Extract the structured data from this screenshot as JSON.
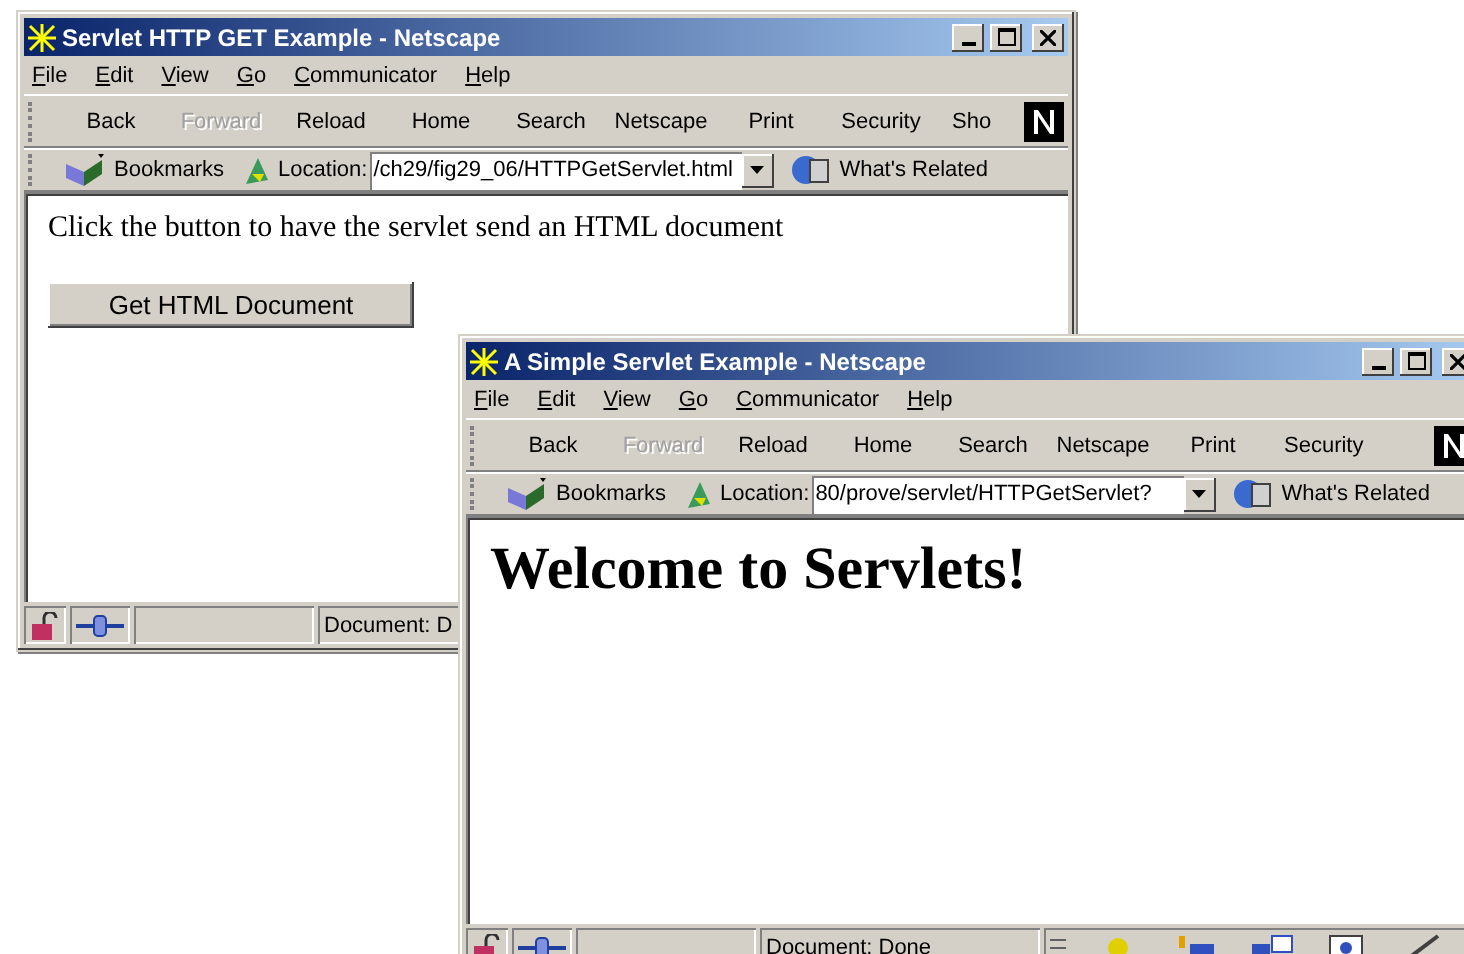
{
  "windows": [
    {
      "title": "Servlet HTTP GET Example - Netscape",
      "menus": [
        "File",
        "Edit",
        "View",
        "Go",
        "Communicator",
        "Help"
      ],
      "toolbar": [
        {
          "label": "Back",
          "disabled": false
        },
        {
          "label": "Forward",
          "disabled": true
        },
        {
          "label": "Reload",
          "disabled": false
        },
        {
          "label": "Home",
          "disabled": false
        },
        {
          "label": "Search",
          "disabled": false
        },
        {
          "label": "Netscape",
          "disabled": false
        },
        {
          "label": "Print",
          "disabled": false
        },
        {
          "label": "Security",
          "disabled": false
        },
        {
          "label": "Sho",
          "disabled": false
        }
      ],
      "bookmarks": "Bookmarks",
      "location_label": "Location:",
      "url": "/ch29/fig29_06/HTTPGetServlet.html",
      "related": "What's Related",
      "content": [
        {
          "kind": "paragraph",
          "text": "Click the button to have the servlet send an HTML document"
        },
        {
          "kind": "button",
          "text": "Get HTML Document"
        }
      ],
      "status": "Document: D",
      "component_bar": false
    },
    {
      "title": "A Simple Servlet Example - Netscape",
      "menus": [
        "File",
        "Edit",
        "View",
        "Go",
        "Communicator",
        "Help"
      ],
      "toolbar": [
        {
          "label": "Back",
          "disabled": false
        },
        {
          "label": "Forward",
          "disabled": true
        },
        {
          "label": "Reload",
          "disabled": false
        },
        {
          "label": "Home",
          "disabled": false
        },
        {
          "label": "Search",
          "disabled": false
        },
        {
          "label": "Netscape",
          "disabled": false
        },
        {
          "label": "Print",
          "disabled": false
        },
        {
          "label": "Security",
          "disabled": false
        }
      ],
      "bookmarks": "Bookmarks",
      "location_label": "Location:",
      "url": "80/prove/servlet/HTTPGetServlet?",
      "related": "What's Related",
      "content": [
        {
          "kind": "heading",
          "text": "Welcome to Servlets!"
        }
      ],
      "status": "Document: Done",
      "component_bar": true
    }
  ]
}
